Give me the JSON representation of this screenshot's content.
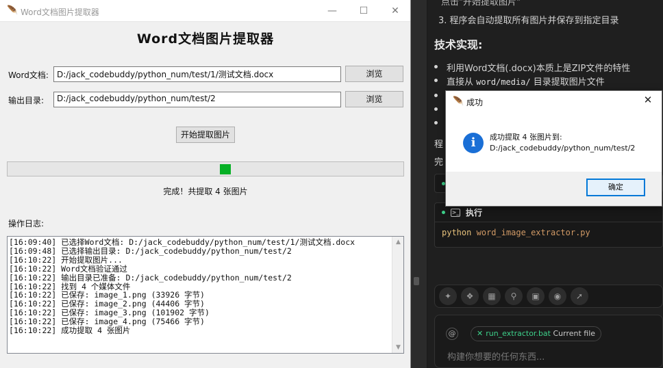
{
  "window": {
    "title": "Word文档图片提取器",
    "minimize": "—",
    "maximize": "☐",
    "close": "✕"
  },
  "app": {
    "heading": "Word文档图片提取器",
    "word_label": "Word文档:",
    "word_path": "D:/jack_codebuddy/python_num/test/1/测试文档.docx",
    "browse1": "浏览",
    "output_label": "输出目录:",
    "output_path": "D:/jack_codebuddy/python_num/test/2",
    "browse2": "浏览",
    "start_button": "开始提取图片",
    "progress_percent": 55,
    "status": "完成！共提取 4 张图片",
    "log_label": "操作日志:",
    "log_lines": [
      "[16:09:40] 已选择Word文档: D:/jack_codebuddy/python_num/test/1/测试文档.docx",
      "[16:09:48] 已选择输出目录: D:/jack_codebuddy/python_num/test/2",
      "[16:10:22] 开始提取图片...",
      "[16:10:22] Word文档验证通过",
      "[16:10:22] 输出目录已准备: D:/jack_codebuddy/python_num/test/2",
      "[16:10:22] 找到 4 个媒体文件",
      "[16:10:22] 已保存: image_1.png (33926 字节)",
      "[16:10:22] 已保存: image_2.png (44406 字节)",
      "[16:10:22] 已保存: image_3.png (101902 字节)",
      "[16:10:22] 已保存: image_4.png (75466 字节)",
      "[16:10:22] 成功提取 4 张图片"
    ]
  },
  "dialog": {
    "title": "成功",
    "message_line1": "成功提取 4 张图片到:",
    "message_line2": "D:/jack_codebuddy/python_num/test/2",
    "ok": "确定",
    "close": "✕",
    "icon": "i"
  },
  "chat": {
    "top_partial": "点击\"开始提取图片\"",
    "step3": "3. 程序会自动提取所有图片并保存到指定目录",
    "tech_heading": "技术实现:",
    "bullet1": "利用Word文档(.docx)本质上是ZIP文件的特性",
    "bullet2_pre": "直接从 ",
    "bullet2_code": "word/media/",
    "bullet2_post": " 目录提取图片文件",
    "partial1": "程",
    "partial2": "完",
    "exec_label": "执行",
    "code_kw": "python",
    "code_file": "word_image_extractor.py",
    "chip_file": "run_extractor.bat",
    "chip_suffix": "Current file",
    "input_placeholder": "构建你想要的任何东西...",
    "at": "@"
  }
}
